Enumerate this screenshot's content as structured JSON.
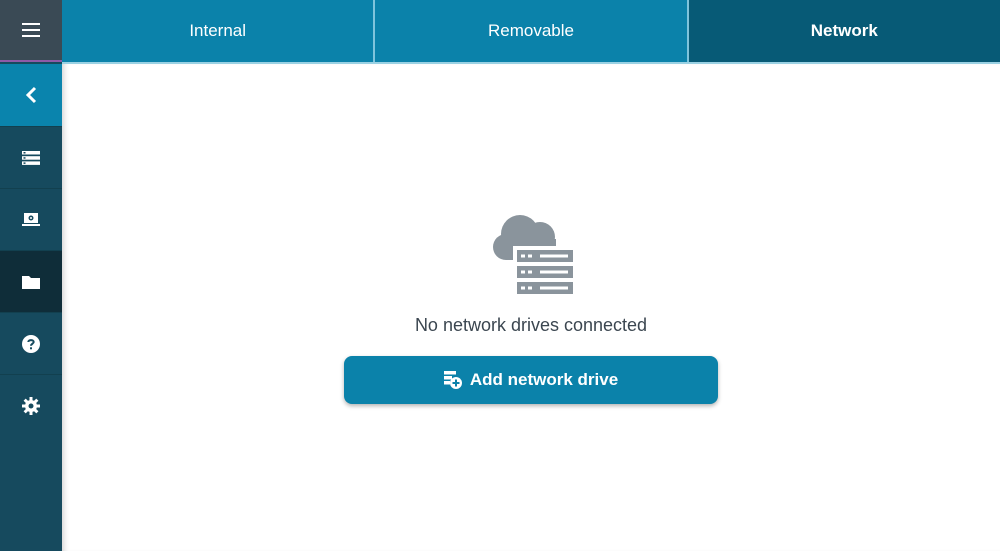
{
  "sidebar": {
    "items": [
      {
        "name": "menu",
        "icon": "hamburger-menu-icon"
      },
      {
        "name": "back",
        "icon": "chevron-left-icon"
      },
      {
        "name": "storage-list",
        "icon": "list-icon"
      },
      {
        "name": "device",
        "icon": "laptop-icon"
      },
      {
        "name": "folder",
        "icon": "folder-icon",
        "active": true
      },
      {
        "name": "help",
        "icon": "help-icon"
      },
      {
        "name": "settings",
        "icon": "gear-icon"
      }
    ]
  },
  "tabs": [
    {
      "label": "Internal",
      "active": false
    },
    {
      "label": "Removable",
      "active": false
    },
    {
      "label": "Network",
      "active": true
    }
  ],
  "main": {
    "empty_icon": "cloud-server-icon",
    "empty_message": "No network drives connected",
    "add_button_label": "Add network drive",
    "add_button_icon": "add-network-drive-icon"
  },
  "colors": {
    "sidebar_bg": "#164a5e",
    "accent": "#0b82aa",
    "active_tab": "#075a76",
    "icon_grey": "#8a949c"
  }
}
